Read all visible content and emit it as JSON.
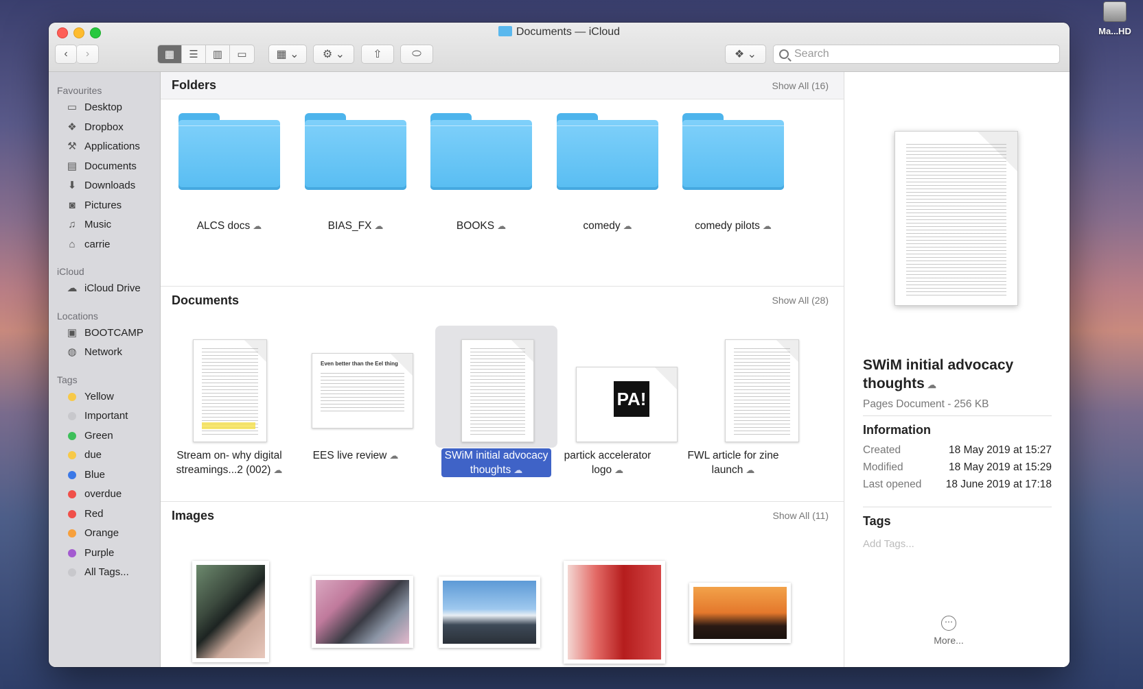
{
  "desktop": {
    "disk_label": "Ma...HD"
  },
  "window": {
    "title": "Documents — iCloud"
  },
  "toolbar": {
    "back": "‹",
    "forward": "›",
    "view_icons": "▦",
    "view_list": "☰",
    "view_columns": "▥",
    "view_gallery": "▭",
    "group": "▦ ⌄",
    "action": "⚙ ⌄",
    "share": "⇧",
    "tag": "⬭",
    "dropbox": "❖ ⌄",
    "search_placeholder": "Search"
  },
  "sidebar": {
    "favourites_head": "Favourites",
    "favourites": [
      {
        "label": "Desktop",
        "icon": "▭"
      },
      {
        "label": "Dropbox",
        "icon": "❖"
      },
      {
        "label": "Applications",
        "icon": "⚒"
      },
      {
        "label": "Documents",
        "icon": "▤"
      },
      {
        "label": "Downloads",
        "icon": "⬇"
      },
      {
        "label": "Pictures",
        "icon": "◙"
      },
      {
        "label": "Music",
        "icon": "♫"
      },
      {
        "label": "carrie",
        "icon": "⌂"
      }
    ],
    "icloud_head": "iCloud",
    "icloud": [
      {
        "label": "iCloud Drive",
        "icon": "☁"
      }
    ],
    "locations_head": "Locations",
    "locations": [
      {
        "label": "BOOTCAMP",
        "icon": "▣"
      },
      {
        "label": "Network",
        "icon": "◍"
      }
    ],
    "tags_head": "Tags",
    "tags": [
      {
        "label": "Yellow",
        "color": "#f7c948"
      },
      {
        "label": "Important",
        "color": "#c8c8cc"
      },
      {
        "label": "Green",
        "color": "#3dbf5a"
      },
      {
        "label": "due",
        "color": "#f7c948"
      },
      {
        "label": "Blue",
        "color": "#3b78e7"
      },
      {
        "label": "overdue",
        "color": "#f0504a"
      },
      {
        "label": "Red",
        "color": "#f0504a"
      },
      {
        "label": "Orange",
        "color": "#f7a03c"
      },
      {
        "label": "Purple",
        "color": "#a35bd0"
      },
      {
        "label": "All Tags...",
        "color": "#c8c8cc"
      }
    ]
  },
  "folders": {
    "heading": "Folders",
    "show_all": "Show All (16)",
    "items": [
      "ALCS docs",
      "BIAS_FX",
      "BOOKS",
      "comedy",
      "comedy pilots"
    ]
  },
  "documents": {
    "heading": "Documents",
    "show_all": "Show All (28)",
    "items": [
      {
        "line1": "Stream on- why digital",
        "line2": "streamings...2 (002)"
      },
      {
        "line1": "EES live review",
        "line2": ""
      },
      {
        "line1": "SWiM initial advocacy",
        "line2": "thoughts"
      },
      {
        "line1": "partick accelerator",
        "line2": "logo"
      },
      {
        "line1": "FWL article for zine",
        "line2": "launch"
      }
    ],
    "thumb_title_ees": "Even better than the Eel thing",
    "thumb_logo": "PA!"
  },
  "images": {
    "heading": "Images",
    "show_all": "Show All (11)"
  },
  "cloud_icon": "☁",
  "preview": {
    "name": "SWiM initial advocacy thoughts",
    "kind": "Pages Document - 256 KB",
    "info_head": "Information",
    "rows": [
      {
        "k": "Created",
        "v": "18 May 2019 at 15:27"
      },
      {
        "k": "Modified",
        "v": "18 May 2019 at 15:29"
      },
      {
        "k": "Last opened",
        "v": "18 June 2019 at 17:18"
      }
    ],
    "tags_head": "Tags",
    "add_tags": "Add Tags...",
    "more": "More..."
  }
}
